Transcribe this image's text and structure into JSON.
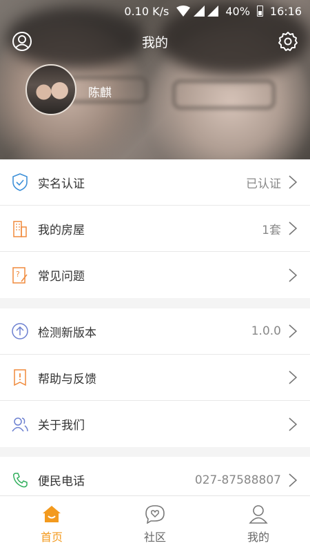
{
  "status_bar": {
    "speed": "0.10 K/s",
    "battery": "40%",
    "time": "16:16"
  },
  "header": {
    "title": "我的",
    "username": "陈麒"
  },
  "group1": [
    {
      "label": "实名认证",
      "value": "已认证",
      "icon": "shield-check-icon"
    },
    {
      "label": "我的房屋",
      "value": "1套",
      "icon": "building-icon"
    },
    {
      "label": "常见问题",
      "value": "",
      "icon": "question-doc-icon"
    }
  ],
  "group2": [
    {
      "label": "检测新版本",
      "value": "1.0.0",
      "icon": "upload-arrow-icon"
    },
    {
      "label": "帮助与反馈",
      "value": "",
      "icon": "feedback-icon"
    },
    {
      "label": "关于我们",
      "value": "",
      "icon": "users-icon"
    }
  ],
  "group3": [
    {
      "label": "便民电话",
      "value": "027-87588807",
      "icon": "phone-icon"
    }
  ],
  "tabs": [
    {
      "label": "首页",
      "icon": "home-icon",
      "active": true
    },
    {
      "label": "社区",
      "icon": "chat-heart-icon",
      "active": false
    },
    {
      "label": "我的",
      "icon": "person-icon",
      "active": false
    }
  ],
  "colors": {
    "accent": "#f39a1e",
    "blue_icon": "#3c8fd8",
    "orange_icon": "#f08a3c",
    "purple_icon": "#6b7fd0",
    "green_icon": "#2fae5b"
  }
}
